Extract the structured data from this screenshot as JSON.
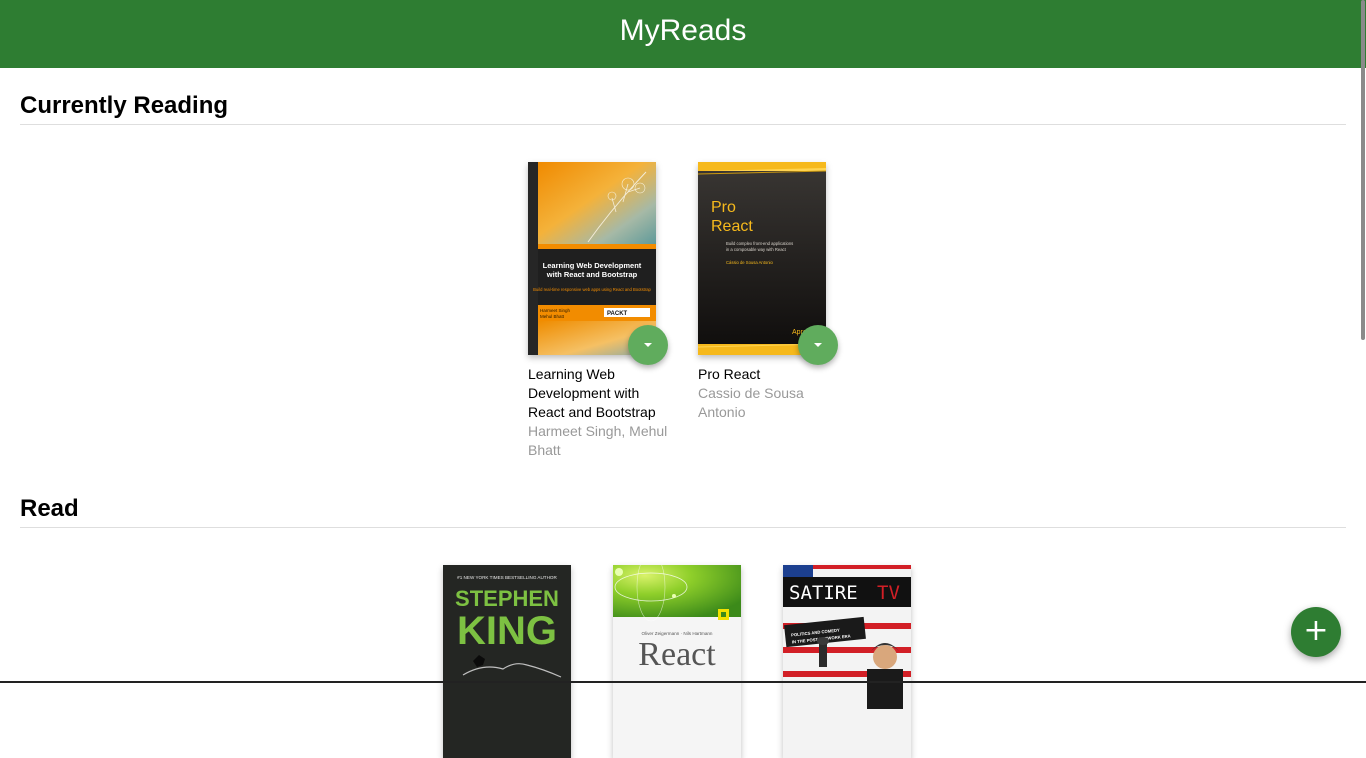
{
  "header": {
    "title": "MyReads"
  },
  "shelves": [
    {
      "title": "Currently Reading",
      "books": [
        {
          "title": "Learning Web Development with React and Bootstrap",
          "authors": "Harmeet Singh, Mehul Bhatt",
          "cover_text": {
            "headline": "Learning Web Development with React and Bootstrap",
            "subline": "Build real-time responsive web apps using React and Bootstrap",
            "cover_authors": "Harmeet Singh\nMehul Bhatt",
            "publisher": "PACKT"
          }
        },
        {
          "title": "Pro React",
          "authors": "Cassio de Sousa Antonio",
          "cover_text": {
            "headline": "Pro React",
            "subline": "Build complex front-end applications in a composable way with React",
            "cover_authors": "Cássio de Sousa Antonio",
            "publisher": "Apress"
          }
        }
      ]
    },
    {
      "title": "Read",
      "books": [
        {
          "cover_text": {
            "tagline": "#1 NEW YORK TIMES BESTSELLING AUTHOR",
            "headline": "STEPHEN KING"
          }
        },
        {
          "cover_text": {
            "tagline": "Oliver Zeigermann · Nils Hartmann",
            "headline": "React"
          }
        },
        {
          "cover_text": {
            "headline": "SATIRE TV",
            "subline": "POLITICS AND COMEDY IN THE POST-NETWORK ERA"
          }
        }
      ]
    }
  ],
  "actions": {
    "add_label": "+"
  },
  "icons": {
    "shelf_changer": "caret-down-icon",
    "add": "plus-icon"
  },
  "colors": {
    "header": "#2e7d32",
    "changer": "#60ac5d",
    "add_button": "#2e7d32",
    "author_text": "#999999"
  }
}
